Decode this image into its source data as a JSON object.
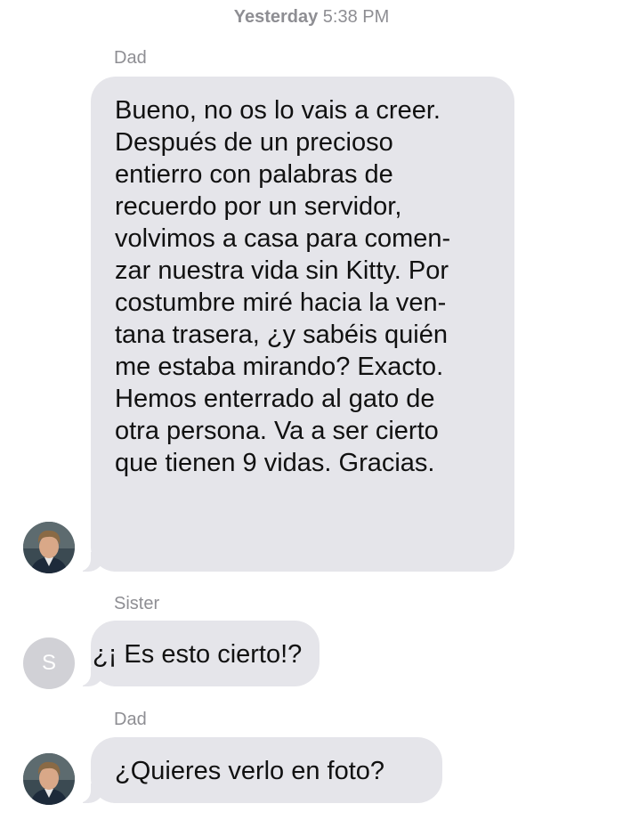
{
  "header": {
    "day": "Yesterday",
    "time": "5:38 PM"
  },
  "messages": [
    {
      "sender": "Dad",
      "avatar": "dad-photo",
      "lines": [
        "Bueno, no os lo vais a creer.",
        "Después de un precioso",
        "entierro con palabras de",
        "recuerdo por un servidor,",
        "volvimos a casa para comen-",
        "zar nuestra vida sin Kitty. Por",
        "costumbre miré hacia la ven-",
        "tana trasera, ¿y sabéis quién",
        "me estaba mirando? Exacto.",
        "Hemos enterrado al gato de",
        "otra persona. Va a ser cierto",
        "que tienen 9 vidas. Gracias."
      ]
    },
    {
      "sender": "Sister",
      "avatar_initial": "S",
      "lines": [
        "¿¡ Es esto cierto!?"
      ]
    },
    {
      "sender": "Dad",
      "avatar": "dad-photo",
      "lines": [
        "¿Quieres verlo en foto?"
      ]
    }
  ],
  "colors": {
    "bubble_bg": "#e5e5ea",
    "meta_text": "#8e8e93",
    "message_text": "#111111"
  }
}
